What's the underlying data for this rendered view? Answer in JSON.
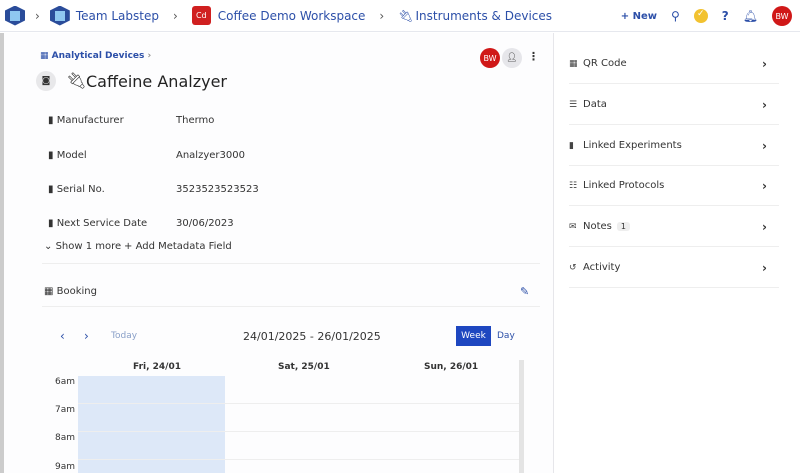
{
  "topbar": {
    "breadcrumbs": [
      "Team Labstep",
      "Coffee Demo Workspace",
      "Instruments & Devices"
    ],
    "workspace_badge": "Cd",
    "new_label": "+ New",
    "help": "?",
    "user_initials": "BW"
  },
  "header": {
    "category": "Analytical Devices",
    "title": "Caffeine Analzyer",
    "user_initials": "BW"
  },
  "metadata": [
    {
      "label": "Manufacturer",
      "value": "Thermo"
    },
    {
      "label": "Model",
      "value": "Analzyer3000"
    },
    {
      "label": "Serial No.",
      "value": "3523523523523"
    },
    {
      "label": "Next Service Date",
      "value": "30/06/2023"
    }
  ],
  "show_more": "Show 1 more",
  "add_metadata": "Add Metadata Field",
  "booking": {
    "label": "Booking",
    "today": "Today",
    "range": "24/01/2025 - 26/01/2025",
    "week": "Week",
    "day": "Day",
    "days": [
      "Fri, 24/01",
      "Sat, 25/01",
      "Sun, 26/01"
    ],
    "hours": [
      "6am",
      "7am",
      "8am",
      "9am"
    ]
  },
  "sidebar": [
    {
      "label": "QR Code",
      "icon": "qr-icon"
    },
    {
      "label": "Data",
      "icon": "database-icon"
    },
    {
      "label": "Linked Experiments",
      "icon": "book-icon"
    },
    {
      "label": "Linked Protocols",
      "icon": "list-icon"
    },
    {
      "label": "Notes",
      "icon": "comments-icon",
      "badge": "1"
    },
    {
      "label": "Activity",
      "icon": "history-icon"
    }
  ]
}
